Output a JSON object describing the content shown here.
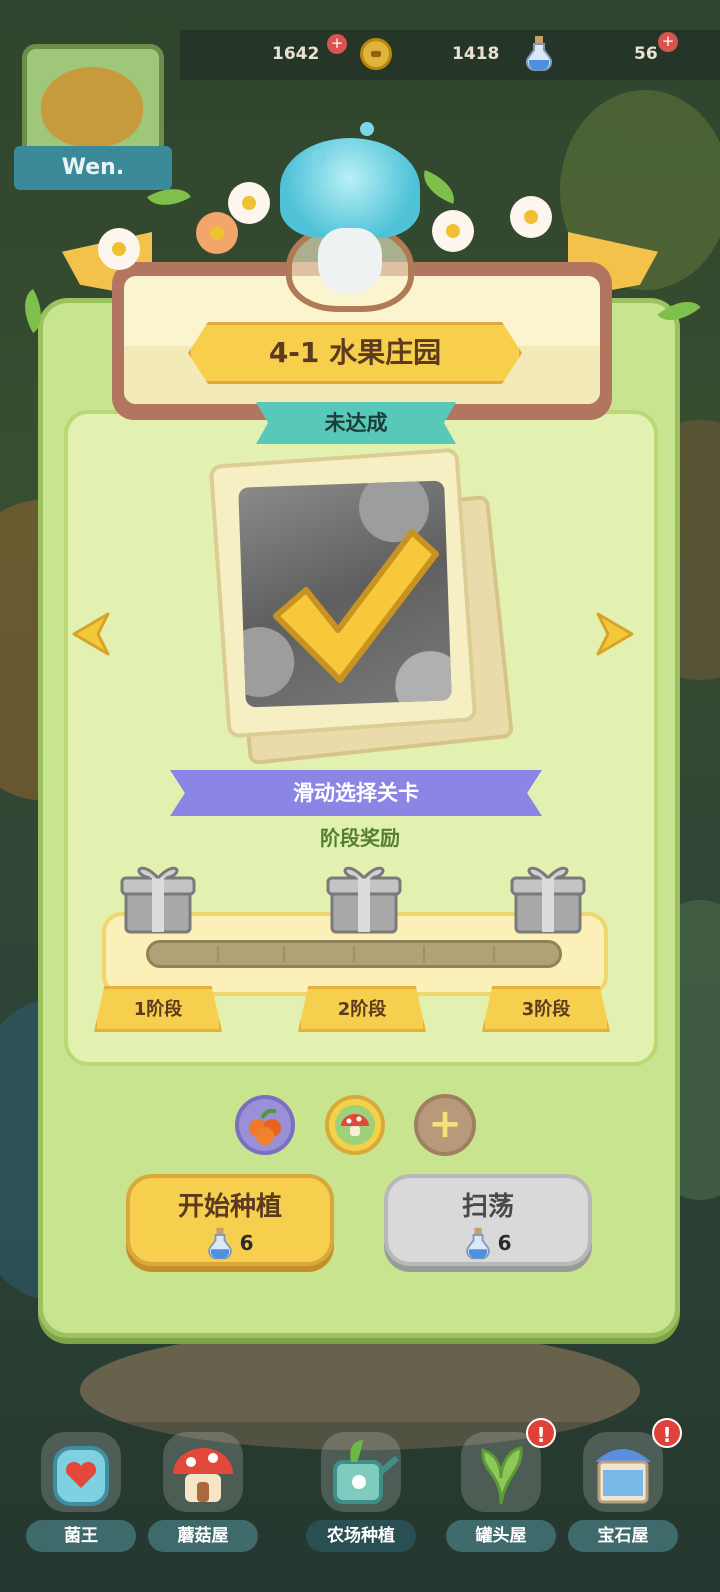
{
  "resources": {
    "mushrooms": "1642",
    "coins": "1418",
    "potions": "56",
    "plus": "+"
  },
  "player": {
    "name": "Wen."
  },
  "level": {
    "title": "4-1 水果庄园",
    "status": "未达成",
    "completed": true
  },
  "swipe_hint": "滑动选择关卡",
  "stage_reward": {
    "label": "阶段奖励",
    "progress": 0,
    "stages": [
      {
        "label": "1阶段"
      },
      {
        "label": "2阶段"
      },
      {
        "label": "3阶段"
      }
    ]
  },
  "boosters": {
    "slots": [
      "berries-icon",
      "mushroom-icon",
      "plus-icon"
    ],
    "add": "+"
  },
  "actions": {
    "start": {
      "label": "开始种植",
      "cost": "6"
    },
    "sweep": {
      "label": "扫荡",
      "cost": "6"
    }
  },
  "bottom_nav": [
    {
      "label": "菌王",
      "icon": "heart-jar-icon"
    },
    {
      "label": "蘑菇屋",
      "icon": "mushroom-house-icon"
    },
    {
      "label": "农场种植",
      "icon": "watering-can-icon",
      "active": true
    },
    {
      "label": "罐头屋",
      "icon": "fern-icon",
      "badge": "!"
    },
    {
      "label": "宝石屋",
      "icon": "gem-shop-icon",
      "badge": "!"
    }
  ],
  "colors": {
    "panel": "#c9e48f",
    "accent_yellow": "#f6cf4f",
    "status_teal": "#58c8b8",
    "swipe_purple": "#8b86e6",
    "badge_red": "#e0423a"
  }
}
